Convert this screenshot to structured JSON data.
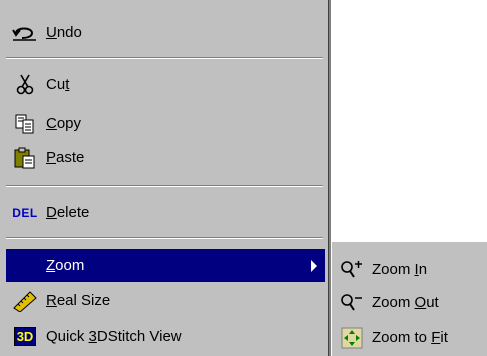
{
  "menu": {
    "items": [
      {
        "pre": "",
        "key": "U",
        "post": "ndo",
        "icon": "undo-icon"
      },
      {
        "pre": "Cu",
        "key": "t",
        "post": "",
        "icon": "scissors-icon"
      },
      {
        "pre": "",
        "key": "C",
        "post": "opy",
        "icon": "copy-icon"
      },
      {
        "pre": "",
        "key": "P",
        "post": "aste",
        "icon": "paste-icon"
      },
      {
        "pre": "",
        "key": "D",
        "post": "elete",
        "icon": "delete-icon",
        "icon_text": "DEL"
      },
      {
        "pre": "",
        "key": "Z",
        "post": "oom",
        "icon": "none"
      },
      {
        "pre": "",
        "key": "R",
        "post": "eal Size",
        "icon": "ruler-icon"
      },
      {
        "pre": "Quick ",
        "key": "3",
        "post": "DStitch View",
        "icon": "3d-icon",
        "icon_text": "3D"
      }
    ]
  },
  "submenu": {
    "items": [
      {
        "pre": "Zoom ",
        "key": "I",
        "post": "n",
        "icon": "zoom-in-icon"
      },
      {
        "pre": "Zoom ",
        "key": "O",
        "post": "ut",
        "icon": "zoom-out-icon"
      },
      {
        "pre": "Zoom to ",
        "key": "F",
        "post": "it",
        "icon": "zoom-to-fit-icon"
      }
    ]
  },
  "colors": {
    "menu_bg": "#c0c0c0",
    "highlight": "#000080",
    "highlight_text": "#ffffff"
  }
}
